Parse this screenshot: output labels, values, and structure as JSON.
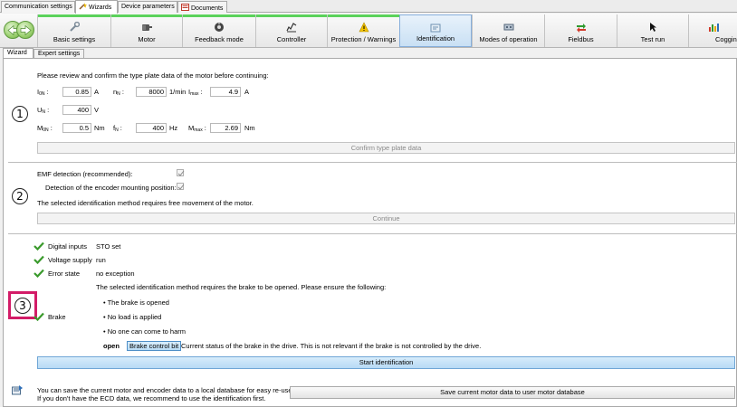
{
  "top_tabs": [
    "Communication settings",
    "Wizards",
    "Device parameters",
    "Documents"
  ],
  "ribbon": [
    {
      "label": "Basic settings",
      "icon": "wrench-icon"
    },
    {
      "label": "Motor",
      "icon": "motor-icon"
    },
    {
      "label": "Feedback mode",
      "icon": "encoder-icon"
    },
    {
      "label": "Controller",
      "icon": "controller-icon"
    },
    {
      "label": "Protection / Warnings",
      "icon": "warning-icon"
    },
    {
      "label": "Identification",
      "icon": "identification-icon"
    },
    {
      "label": "Modes of operation",
      "icon": "modes-icon"
    },
    {
      "label": "Fieldbus",
      "icon": "fieldbus-icon"
    },
    {
      "label": "Test run",
      "icon": "cursor-icon"
    },
    {
      "label": "Cogging",
      "icon": "cogging-icon"
    }
  ],
  "sub_tabs": [
    "Wizard",
    "Expert settings"
  ],
  "steps": [
    "1",
    "2",
    "3"
  ],
  "section1": {
    "intro": "Please review and confirm the type plate data of the motor before continuing:",
    "i_n": {
      "label": "I",
      "sub": "0N",
      "value": "0.85",
      "unit": "A"
    },
    "n_n": {
      "label": "n",
      "sub": "N",
      "value": "8000",
      "unit": "1/min"
    },
    "i_max": {
      "label": "I",
      "sub": "max",
      "value": "4.9",
      "unit": "A"
    },
    "u_n": {
      "label": "U",
      "sub": "N",
      "value": "400",
      "unit": "V"
    },
    "m_0n": {
      "label": "M",
      "sub": "0N",
      "value": "0.5",
      "unit": "Nm"
    },
    "f_n": {
      "label": "f",
      "sub": "N",
      "value": "400",
      "unit": "Hz"
    },
    "m_max": {
      "label": "M",
      "sub": "max",
      "value": "2.69",
      "unit": "Nm"
    },
    "confirm_button": "Confirm type plate data"
  },
  "section2": {
    "emf_label": "EMF detection (recommended):",
    "encoder_label": "Detection of the encoder mounting position:",
    "note": "The selected identification method requires free movement of the motor.",
    "continue_button": "Continue"
  },
  "section3": {
    "status_rows": [
      {
        "label": "Digital inputs",
        "value": "STO set"
      },
      {
        "label": "Voltage supply",
        "value": "run"
      },
      {
        "label": "Error state",
        "value": "no exception"
      }
    ],
    "brake_intro": "The selected identification method requires the brake to be opened. Please ensure the following:",
    "brake_label": "Brake",
    "brake_bullets": [
      "The brake is opened",
      "No load is applied",
      "No one can come to harm"
    ],
    "brake_state": "open",
    "brake_button": "Brake control bit",
    "brake_note": "Current status of the brake in the drive. This is not relevant if the brake is not controlled by the drive.",
    "start_button": "Start identification"
  },
  "footer": {
    "line1": "You can save the current motor and encoder data to a local database for easy re-use.",
    "line2": "If you don't have the ECD data, we recommend to use the identification first.",
    "save_button": "Save current motor data to user motor database"
  },
  "colors": {
    "accent_green": "#5bd25b",
    "highlight": "#d31c68",
    "check": "#3a9a2c"
  }
}
